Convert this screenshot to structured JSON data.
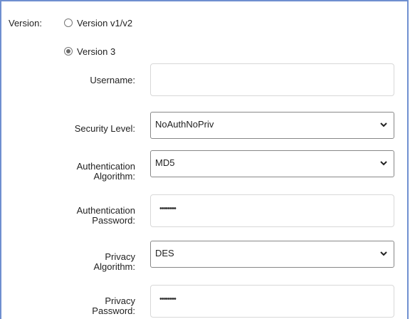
{
  "version": {
    "label": "Version:",
    "options": [
      {
        "label": "Version v1/v2",
        "selected": false
      },
      {
        "label": "Version 3",
        "selected": true
      }
    ]
  },
  "username": {
    "label": "Username:",
    "value": ""
  },
  "security_level": {
    "label": "Security Level:",
    "value": "NoAuthNoPriv"
  },
  "auth_algorithm": {
    "label_line1": "Authentication",
    "label_line2": "Algorithm:",
    "value": "MD5"
  },
  "auth_password": {
    "label_line1": "Authentication",
    "label_line2": "Password:",
    "value": "••••••••"
  },
  "privacy_algorithm": {
    "label_line1": "Privacy",
    "label_line2": "Algorithm:",
    "value": "DES"
  },
  "privacy_password": {
    "label_line1": "Privacy",
    "label_line2": "Password:",
    "value": "••••••••"
  },
  "colors": {
    "frame_border": "#6f8fd0",
    "field_border": "#d8d8d8",
    "select_border": "#888888"
  },
  "icons": {
    "dropdown": "chevron-down-icon"
  }
}
